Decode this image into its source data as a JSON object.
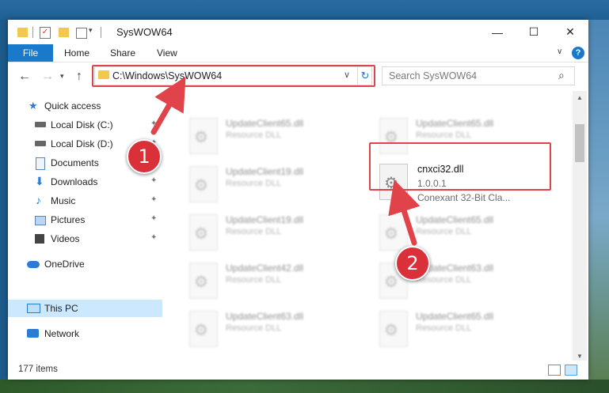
{
  "window": {
    "title": "SysWOW64",
    "min": "—",
    "max": "☐",
    "close": "✕"
  },
  "ribbon": {
    "file": "File",
    "tabs": [
      "Home",
      "Share",
      "View"
    ],
    "help": "?"
  },
  "nav": {
    "back": "←",
    "forward": "→",
    "up": "↑",
    "address": "C:\\Windows\\SysWOW64",
    "search_placeholder": "Search SysWOW64"
  },
  "sidebar": {
    "items": [
      {
        "label": "Quick access"
      },
      {
        "label": "Local Disk (C:)"
      },
      {
        "label": "Local Disk (D:)"
      },
      {
        "label": "Documents"
      },
      {
        "label": "Downloads"
      },
      {
        "label": "Music"
      },
      {
        "label": "Pictures"
      },
      {
        "label": "Videos"
      },
      {
        "label": "OneDrive"
      },
      {
        "label": "This PC"
      },
      {
        "label": "Network"
      }
    ]
  },
  "files": {
    "left": [
      {
        "name": "UpdateClient65.dll",
        "desc": "Resource DLL"
      },
      {
        "name": "UpdateClient19.dll",
        "desc": "Resource DLL"
      },
      {
        "name": "UpdateClient19.dll",
        "desc": "Resource DLL"
      },
      {
        "name": "UpdateClient42.dll",
        "desc": "Resource DLL"
      },
      {
        "name": "UpdateClient63.dll",
        "desc": "Resource DLL"
      }
    ],
    "right": [
      {
        "name": "UpdateClient65.dll",
        "desc": "Resource DLL"
      },
      {
        "name": "UpdateClient65.dll",
        "desc": "Resource DLL"
      },
      {
        "name": "UpdateClient63.dll",
        "desc": "Resource DLL"
      },
      {
        "name": "UpdateClient65.dll",
        "desc": "Resource DLL"
      }
    ],
    "highlight": {
      "name": "cnxci32.dll",
      "version": "1.0.0.1",
      "company": "Conexant 32-Bit Cla..."
    }
  },
  "status": {
    "items": "177 items"
  },
  "annotations": {
    "step1": "1",
    "step2": "2",
    "color": "#e0434a"
  }
}
